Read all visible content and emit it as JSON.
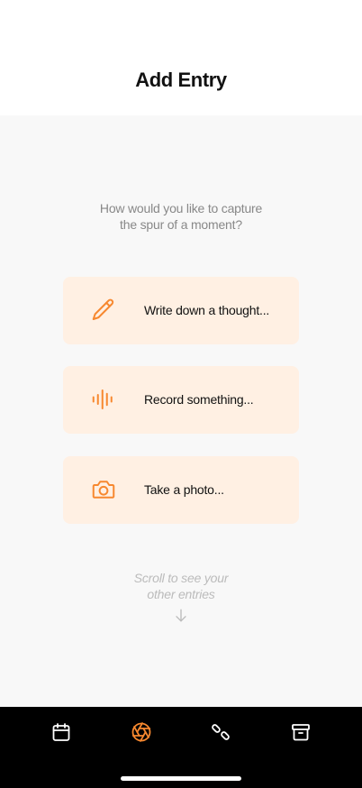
{
  "header": {
    "title": "Add Entry"
  },
  "main": {
    "prompt_line1": "How would you like to capture",
    "prompt_line2": "the spur of a moment?",
    "options": [
      {
        "label": "Write down a thought...",
        "icon": "pencil-icon"
      },
      {
        "label": "Record something...",
        "icon": "audio-waveform-icon"
      },
      {
        "label": "Take a photo...",
        "icon": "camera-icon"
      }
    ],
    "hint_line1": "Scroll to see your",
    "hint_line2": "other entries"
  },
  "tabbar": {
    "tabs": [
      {
        "icon": "calendar-icon",
        "active": false
      },
      {
        "icon": "aperture-icon",
        "active": true
      },
      {
        "icon": "shapes-icon",
        "active": false
      },
      {
        "icon": "archive-icon",
        "active": false
      }
    ]
  },
  "colors": {
    "accent": "#f7882f",
    "option_bg": "#fff0e3",
    "content_bg": "#f8f8f8",
    "tabbar_bg": "#000000",
    "muted_text": "#888888"
  }
}
